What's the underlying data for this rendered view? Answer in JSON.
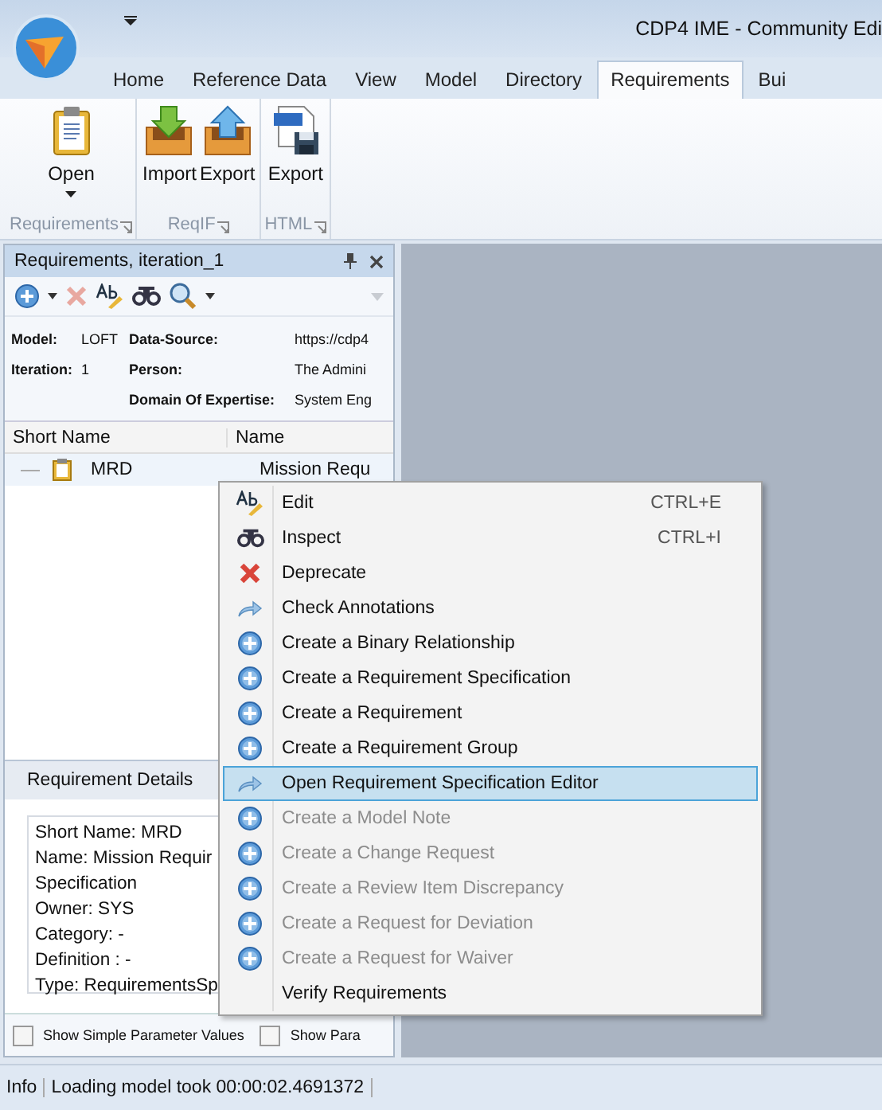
{
  "window": {
    "title": "CDP4 IME - Community Edi"
  },
  "ribbon_tabs": [
    {
      "label": "Home",
      "selected": false
    },
    {
      "label": "Reference Data",
      "selected": false
    },
    {
      "label": "View",
      "selected": false
    },
    {
      "label": "Model",
      "selected": false
    },
    {
      "label": "Directory",
      "selected": false
    },
    {
      "label": "Requirements",
      "selected": true
    },
    {
      "label": "Bui",
      "selected": false
    }
  ],
  "ribbon_groups": [
    {
      "label": "Requirements",
      "buttons": [
        {
          "label": "Open",
          "kind": "clipboard",
          "dropdown": true
        }
      ]
    },
    {
      "label": "ReqIF",
      "buttons": [
        {
          "label": "Import",
          "kind": "import",
          "dropdown": false
        },
        {
          "label": "Export",
          "kind": "export",
          "dropdown": false
        }
      ]
    },
    {
      "label": "HTML",
      "buttons": [
        {
          "label": "Export",
          "kind": "html",
          "dropdown": false
        }
      ]
    }
  ],
  "panel": {
    "title": "Requirements, iteration_1",
    "info": [
      {
        "label": "Model:",
        "value": "LOFT"
      },
      {
        "label": "Data-Source:",
        "value": "https://cdp4"
      },
      {
        "label": "Iteration:",
        "value": "1"
      },
      {
        "label": "Person:",
        "value": "The Admini"
      },
      {
        "label": "Domain Of Expertise:",
        "value": "System Eng"
      }
    ],
    "columns": [
      "Short Name",
      "Name"
    ],
    "rows": [
      {
        "short_name": "MRD",
        "name": "Mission Requ"
      }
    ],
    "details_tab": "Requirement Details",
    "details": [
      "Short Name: MRD",
      "Name: Mission Requir",
      "Specification",
      "Owner: SYS",
      "Category: -",
      "Definition : -",
      "Type: RequirementsSp"
    ],
    "checkboxes": [
      {
        "label": "Show Simple Parameter Values",
        "checked": false
      },
      {
        "label": "Show Para",
        "checked": false
      }
    ]
  },
  "context_menu": [
    {
      "label": "Edit",
      "kind": "edit",
      "shortcut": "CTRL+E",
      "disabled": false,
      "selected": false
    },
    {
      "label": "Inspect",
      "kind": "inspect",
      "shortcut": "CTRL+I",
      "disabled": false,
      "selected": false
    },
    {
      "label": "Deprecate",
      "kind": "deprecate",
      "disabled": false,
      "selected": false
    },
    {
      "label": "Check Annotations",
      "kind": "arrow",
      "disabled": false,
      "selected": false
    },
    {
      "label": "Create a Binary Relationship",
      "kind": "plus",
      "disabled": false,
      "selected": false
    },
    {
      "label": "Create a Requirement Specification",
      "kind": "plus",
      "disabled": false,
      "selected": false
    },
    {
      "label": "Create a Requirement",
      "kind": "plus",
      "disabled": false,
      "selected": false
    },
    {
      "label": "Create a Requirement Group",
      "kind": "plus",
      "disabled": false,
      "selected": false
    },
    {
      "label": "Open Requirement Specification Editor",
      "kind": "arrow",
      "disabled": false,
      "selected": true
    },
    {
      "label": "Create a Model Note",
      "kind": "plus",
      "disabled": true,
      "selected": false
    },
    {
      "label": "Create a Change Request",
      "kind": "plus",
      "disabled": true,
      "selected": false
    },
    {
      "label": "Create a Review Item Discrepancy",
      "kind": "plus",
      "disabled": true,
      "selected": false
    },
    {
      "label": "Create a Request for Deviation",
      "kind": "plus",
      "disabled": true,
      "selected": false
    },
    {
      "label": "Create a Request for Waiver",
      "kind": "plus",
      "disabled": true,
      "selected": false
    },
    {
      "label": "Verify Requirements",
      "kind": "none",
      "disabled": false,
      "selected": false
    }
  ],
  "status_bar": {
    "label": "Info",
    "message": "Loading model took 00:00:02.4691372"
  }
}
